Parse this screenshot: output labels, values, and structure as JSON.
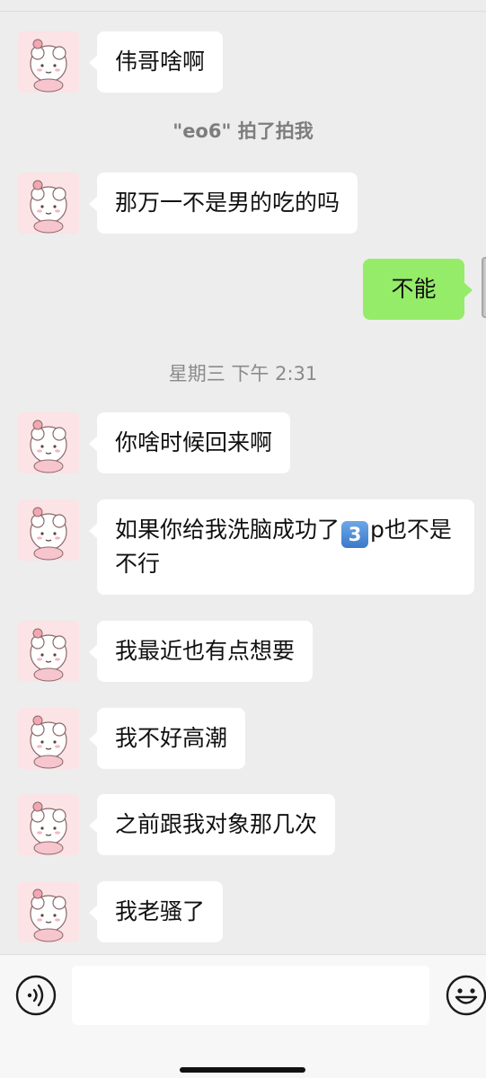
{
  "messages": [
    {
      "text": "伟哥啥啊"
    },
    {
      "text": "那万一不是男的吃的吗"
    },
    {
      "text": "不能"
    },
    {
      "text": "你啥时候回来啊"
    },
    {
      "text_a": "如果你给我洗脑成功了",
      "keycap": "3",
      "text_b": "p也不是不行"
    },
    {
      "text": "我最近也有点想要"
    },
    {
      "text": "我不好高潮"
    },
    {
      "text": "之前跟我对象那几次"
    },
    {
      "text": "我老骚了"
    }
  ],
  "system": {
    "pat_notice": "\"eo6\" 拍了拍我",
    "timestamp": "星期三 下午 2:31"
  },
  "input": {
    "value": ""
  },
  "icons": {
    "voice": "voice-icon",
    "emoji": "emoji-icon",
    "avatar": "sheep-avatar"
  },
  "colors": {
    "background": "#ededed",
    "my_bubble": "#95ec69",
    "their_bubble": "#ffffff"
  }
}
